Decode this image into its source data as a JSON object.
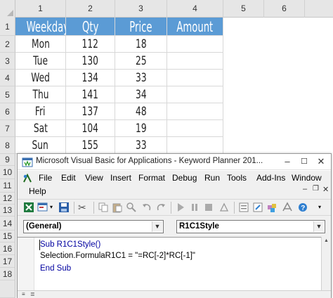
{
  "sheet": {
    "columns": [
      "1",
      "2",
      "3",
      "4",
      "5",
      "6"
    ],
    "rows": [
      "1",
      "2",
      "3",
      "4",
      "5",
      "6",
      "7",
      "8",
      "9",
      "10",
      "11",
      "12",
      "13",
      "14",
      "15",
      "16",
      "17",
      "18"
    ],
    "header": [
      "Weekday",
      "Qty",
      "Price",
      "Amount"
    ],
    "data": [
      [
        "Mon",
        "112",
        "18",
        ""
      ],
      [
        "Tue",
        "130",
        "25",
        ""
      ],
      [
        "Wed",
        "134",
        "33",
        ""
      ],
      [
        "Thu",
        "141",
        "34",
        ""
      ],
      [
        "Fri",
        "137",
        "48",
        ""
      ],
      [
        "Sat",
        "104",
        "19",
        ""
      ],
      [
        "Sun",
        "155",
        "33",
        ""
      ]
    ],
    "header_color": "#5b9bd5"
  },
  "vba": {
    "title": "Microsoft Visual Basic for Applications - Keyword Planner 201...",
    "window_buttons": {
      "minimize": "–",
      "maximize": "☐",
      "close": "✕"
    },
    "menu": [
      "File",
      "Edit",
      "View",
      "Insert",
      "Format",
      "Debug",
      "Run",
      "Tools",
      "Add-Ins",
      "Window"
    ],
    "menu_help": "Help",
    "object_combo": "(General)",
    "proc_combo": "R1C1Style",
    "code": {
      "line1": "Sub R1C1Style()",
      "line2": "Selection.FormulaR1C1 = \"=RC[-2]*RC[-1]\"",
      "line3": "End Sub"
    },
    "toolbar_icons": [
      "excel-icon",
      "insert-userform-icon",
      "save-icon",
      "cut-icon",
      "copy-icon",
      "paste-icon",
      "find-icon",
      "undo-icon",
      "redo-icon",
      "run-icon",
      "break-icon",
      "reset-icon",
      "design-mode-icon",
      "project-explorer-icon",
      "properties-icon",
      "object-browser-icon",
      "toolbox-icon",
      "help-icon"
    ]
  }
}
